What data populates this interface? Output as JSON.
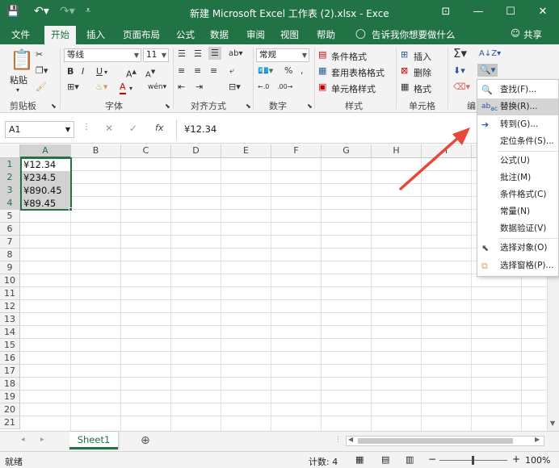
{
  "titlebar": {
    "title": "新建 Microsoft Excel 工作表 (2).xlsx  -  Exce",
    "minimize": "—",
    "restore": "☐",
    "close": "✕",
    "ribbon_options": "⊡"
  },
  "tabs": [
    "文件",
    "开始",
    "插入",
    "页面布局",
    "公式",
    "数据",
    "审阅",
    "视图",
    "帮助"
  ],
  "tell_me": "告诉我你想要做什么",
  "share": "共享",
  "ribbon": {
    "clipboard": {
      "paste": "粘贴",
      "label": "剪贴板"
    },
    "font": {
      "name": "等线",
      "size": "11",
      "label": "字体",
      "bold": "B",
      "italic": "I",
      "underline": "U"
    },
    "alignment": {
      "label": "对齐方式"
    },
    "number": {
      "format": "常规",
      "label": "数字",
      "percent": "%"
    },
    "styles": {
      "conditional": "条件格式",
      "table": "套用表格格式",
      "cell_styles": "单元格样式",
      "label": "样式"
    },
    "cells": {
      "insert": "插入",
      "delete": "删除",
      "format": "格式",
      "label": "单元格"
    },
    "editing": {
      "label": "编"
    }
  },
  "formula_bar": {
    "name_box": "A1",
    "fx": "fx",
    "value": "¥12.34"
  },
  "columns": [
    "A",
    "B",
    "C",
    "D",
    "E",
    "F",
    "G",
    "H",
    "I"
  ],
  "rows": [
    "1",
    "2",
    "3",
    "4",
    "5",
    "6",
    "7",
    "8",
    "9",
    "10",
    "11",
    "12",
    "13",
    "14",
    "15",
    "16",
    "17",
    "18",
    "19",
    "20",
    "21"
  ],
  "cells": {
    "A1": "¥12.34",
    "A2": "¥234.5",
    "A3": "¥890.45",
    "A4": "¥89.45"
  },
  "sheet": {
    "name": "Sheet1",
    "add": "⊕"
  },
  "status": {
    "ready": "就绪",
    "count_label": "计数: 4",
    "zoom": "100%"
  },
  "find_menu": {
    "items": [
      {
        "label": "查找(F)...",
        "icon": "magnifier-icon"
      },
      {
        "label": "替换(R)...",
        "icon": "replace-icon"
      },
      {
        "label": "转到(G)...",
        "icon": "arrow-right-icon"
      },
      {
        "label": "定位条件(S)...",
        "icon": ""
      },
      {
        "label": "公式(U)",
        "icon": ""
      },
      {
        "label": "批注(M)",
        "icon": ""
      },
      {
        "label": "条件格式(C)",
        "icon": ""
      },
      {
        "label": "常量(N)",
        "icon": ""
      },
      {
        "label": "数据验证(V)",
        "icon": ""
      },
      {
        "label": "选择对象(O)",
        "icon": "cursor-icon"
      },
      {
        "label": "选择窗格(P)...",
        "icon": "selection-pane-icon"
      }
    ]
  },
  "colors": {
    "accent": "#217346",
    "arrow": "#e8473a",
    "selection_fill": "#d2d2d2"
  }
}
